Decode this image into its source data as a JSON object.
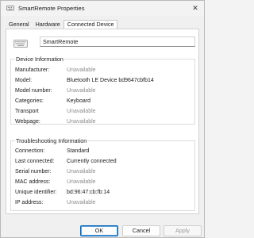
{
  "window": {
    "title": "SmartRemote Properties",
    "close_glyph": "✕"
  },
  "tabs": [
    {
      "label": "General"
    },
    {
      "label": "Hardware"
    },
    {
      "label": "Connected Device"
    }
  ],
  "device_name": "SmartRemote",
  "device_info": {
    "title": "Device Information",
    "rows": [
      {
        "label": "Manufacturer:",
        "value": "Unavailable",
        "muted": true
      },
      {
        "label": "Model:",
        "value": "Bluetooth LE Device bd9647cbfb14",
        "muted": false
      },
      {
        "label": "Model number:",
        "value": "Unavailable",
        "muted": true
      },
      {
        "label": "Categories:",
        "value": "Keyboard",
        "muted": false
      },
      {
        "label": "Transport",
        "value": "Unavailable",
        "muted": true
      },
      {
        "label": "Webpage:",
        "value": "Unavailable",
        "muted": true
      }
    ]
  },
  "troubleshooting": {
    "title": "Troubleshooting Information",
    "rows": [
      {
        "label": "Connection:",
        "value": "Standard",
        "muted": false
      },
      {
        "label": "Last connected:",
        "value": "Currently connected",
        "muted": false
      },
      {
        "label": "Serial number:",
        "value": "Unavailable",
        "muted": true
      },
      {
        "label": "MAC address:",
        "value": "Unavailable",
        "muted": true
      },
      {
        "label": "Unique identifier:",
        "value": "bd:96:47:cb:fb:14",
        "muted": false
      },
      {
        "label": "IP address:",
        "value": "Unavailable",
        "muted": true
      }
    ]
  },
  "buttons": {
    "ok": "OK",
    "cancel": "Cancel",
    "apply": "Apply"
  },
  "colors": {
    "accent": "#0067c0",
    "muted_text": "#8c8c8c"
  }
}
